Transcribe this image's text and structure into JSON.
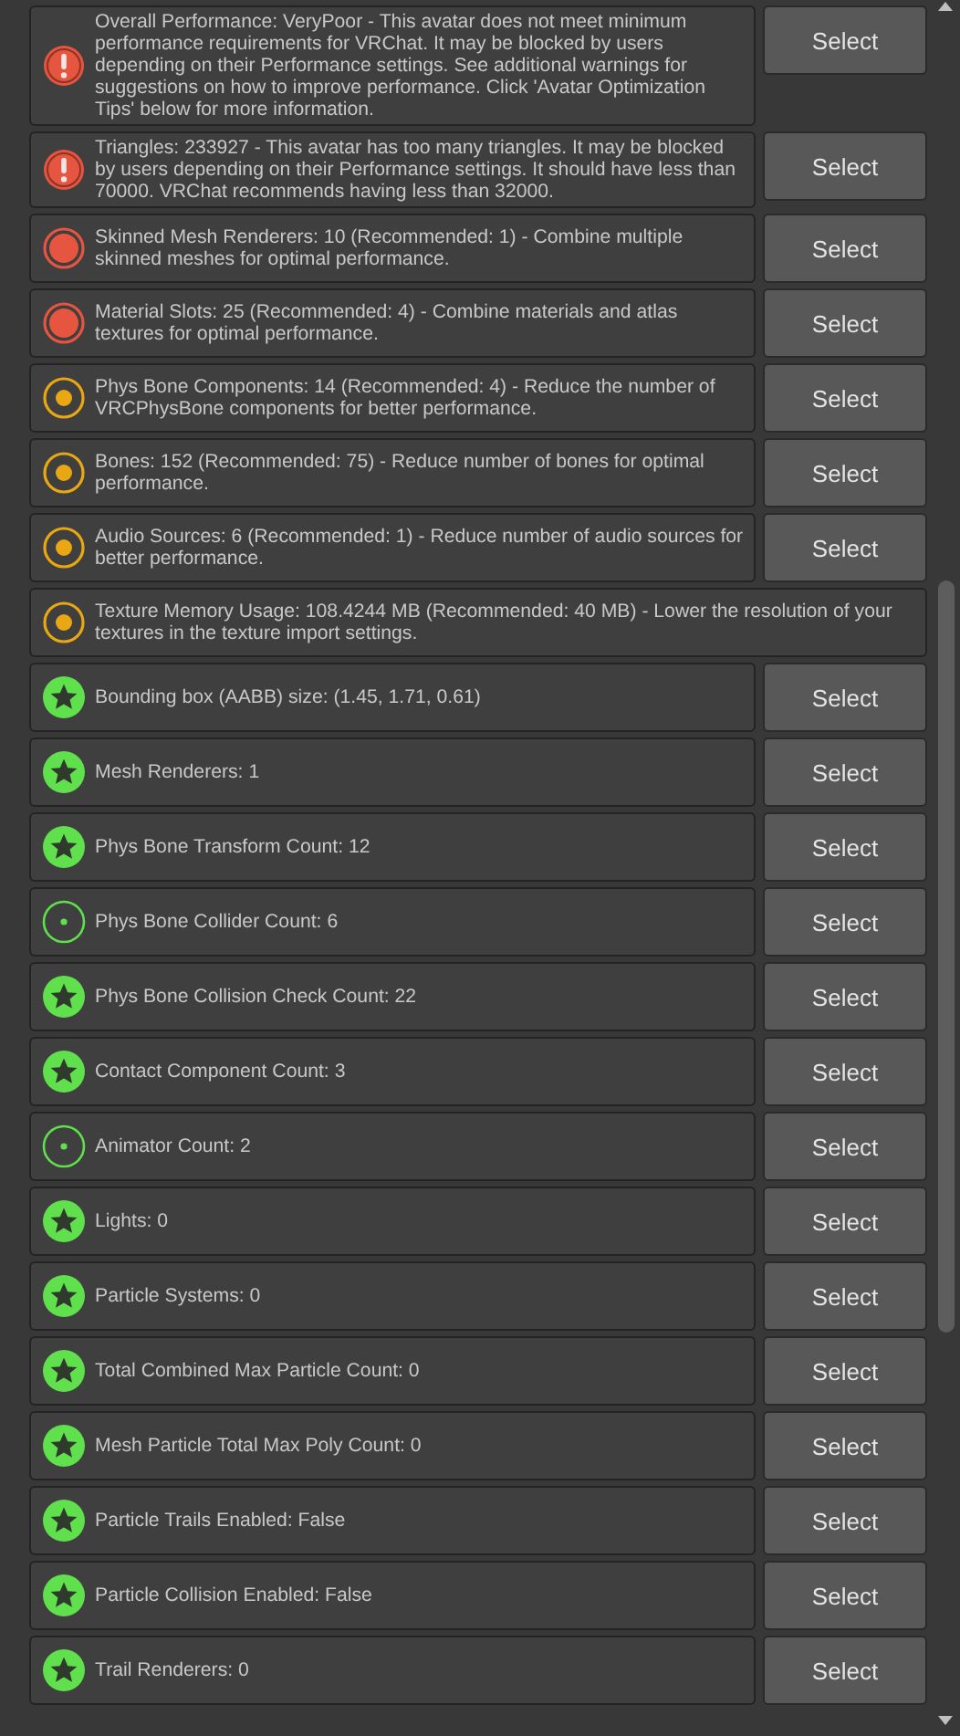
{
  "items": [
    {
      "kind": "error",
      "message": "Overall Performance: VeryPoor - This avatar does not meet minimum performance requirements for VRChat. It may be blocked by users depending on their Performance settings. See additional warnings for suggestions on how to improve performance. Click 'Avatar Optimization Tips' below for more information.",
      "button": "Select"
    },
    {
      "kind": "error",
      "message": "Triangles: 233927 - This avatar has too many triangles. It may be blocked by users depending on their Performance settings. It should have less than 70000. VRChat recommends having less than 32000.",
      "button": "Select"
    },
    {
      "kind": "poor",
      "message": "Skinned Mesh Renderers: 10 (Recommended: 1) - Combine multiple skinned meshes for optimal performance.",
      "button": "Select"
    },
    {
      "kind": "poor",
      "message": "Material Slots: 25 (Recommended: 4) - Combine materials and atlas textures for optimal performance.",
      "button": "Select"
    },
    {
      "kind": "medium",
      "message": "Phys Bone Components: 14 (Recommended: 4) - Reduce the number of VRCPhysBone components for better performance.",
      "button": "Select"
    },
    {
      "kind": "medium",
      "message": "Bones: 152 (Recommended: 75) - Reduce number of bones for optimal performance.",
      "button": "Select"
    },
    {
      "kind": "medium",
      "message": "Audio Sources: 6 (Recommended: 1) - Reduce number of audio sources for better performance.",
      "button": "Select"
    },
    {
      "kind": "medium",
      "message": "Texture Memory Usage: 108.4244 MB (Recommended: 40 MB) - Lower the resolution of your textures in the texture import settings."
    },
    {
      "kind": "excellent",
      "message": "Bounding box (AABB) size: (1.45, 1.71, 0.61)",
      "button": "Select"
    },
    {
      "kind": "excellent",
      "message": "Mesh Renderers: 1",
      "button": "Select"
    },
    {
      "kind": "excellent",
      "message": "Phys Bone Transform Count: 12",
      "button": "Select"
    },
    {
      "kind": "good",
      "message": "Phys Bone Collider Count: 6",
      "button": "Select"
    },
    {
      "kind": "excellent",
      "message": "Phys Bone Collision Check Count: 22",
      "button": "Select"
    },
    {
      "kind": "excellent",
      "message": "Contact Component Count: 3",
      "button": "Select"
    },
    {
      "kind": "good",
      "message": "Animator Count: 2",
      "button": "Select"
    },
    {
      "kind": "excellent",
      "message": "Lights: 0",
      "button": "Select"
    },
    {
      "kind": "excellent",
      "message": "Particle Systems: 0",
      "button": "Select"
    },
    {
      "kind": "excellent",
      "message": "Total Combined Max Particle Count: 0",
      "button": "Select"
    },
    {
      "kind": "excellent",
      "message": "Mesh Particle Total Max Poly Count: 0",
      "button": "Select"
    },
    {
      "kind": "excellent",
      "message": "Particle Trails Enabled: False",
      "button": "Select"
    },
    {
      "kind": "excellent",
      "message": "Particle Collision Enabled: False",
      "button": "Select"
    },
    {
      "kind": "excellent",
      "message": "Trail Renderers: 0",
      "button": "Select"
    }
  ]
}
